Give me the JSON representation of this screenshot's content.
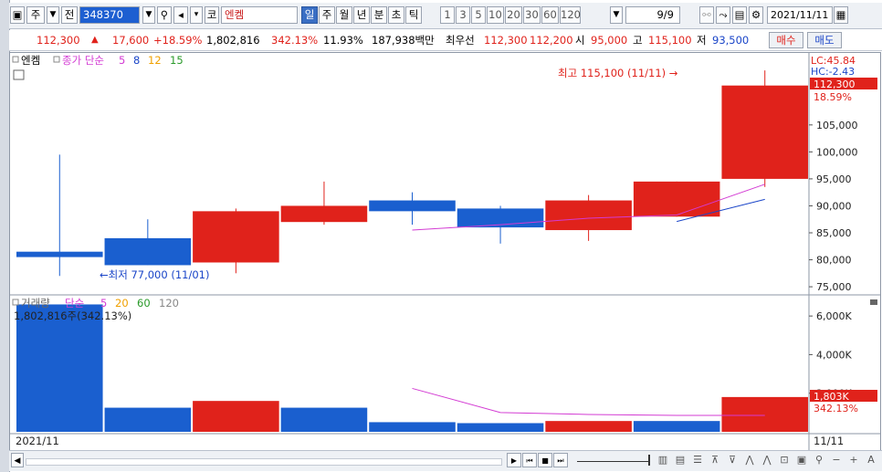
{
  "toolbar": {
    "type_label": "주",
    "jeon_label": "전",
    "code": "348370",
    "market_label": "코",
    "name": "엔켐",
    "periods": [
      "일",
      "주",
      "월",
      "년",
      "분",
      "초",
      "틱"
    ],
    "selected_period": "일",
    "intervals": [
      "1",
      "3",
      "5",
      "10",
      "20",
      "30",
      "60",
      "120"
    ],
    "page_label": "9/9",
    "date": "2021/11/11"
  },
  "quote": {
    "price": "112,300",
    "arrow": "▲",
    "change": "17,600",
    "change_pct": "+18.59%",
    "volume": "1,802,816",
    "volume_ratio": "342.13%",
    "turnover": "11.93%",
    "amount": "187,938백만",
    "best_label": "최우선",
    "ask": "112,300",
    "bid": "112,200",
    "open_label": "시",
    "open": "95,000",
    "high_label": "고",
    "high": "115,100",
    "low_label": "저",
    "low": "93,500",
    "buy_label": "매수",
    "sell_label": "매도"
  },
  "price_panel": {
    "legend_name": "엔켐",
    "legend_ma": "종가 단순",
    "ma_periods": [
      {
        "p": "5",
        "color": "#d33bd3"
      },
      {
        "p": "8",
        "color": "#1a45c8"
      },
      {
        "p": "12",
        "color": "#f0a000"
      },
      {
        "p": "15",
        "color": "#2a9a2a"
      }
    ],
    "lc": "LC:45.84",
    "hc": "HC:-2.43",
    "last_price_tag": "112,300",
    "last_pct_tag": "18.59%",
    "high_note": "최고 115,100 (11/11) →",
    "low_note": "←최저 77,000 (11/01)"
  },
  "volume_panel": {
    "legend_name": "거래량",
    "legend_ma": "단순",
    "ma_periods": [
      {
        "p": "5",
        "color": "#d33bd3"
      },
      {
        "p": "20",
        "color": "#f0a000"
      },
      {
        "p": "60",
        "color": "#2a9a2a"
      },
      {
        "p": "120",
        "color": "#888888"
      }
    ],
    "value_text": "1,802,816주(342.13%)",
    "last_vol_tag": "1,803K",
    "last_pct_tag": "342.13%"
  },
  "x_axis": {
    "left_label": "2021/11",
    "right_label": "11/11"
  },
  "chart_data": [
    {
      "type": "candlestick",
      "title": "엔켐",
      "price_ticks": [
        75000,
        80000,
        85000,
        90000,
        95000,
        100000,
        105000
      ],
      "ylim": [
        74000,
        118000
      ],
      "candles": [
        {
          "open": 80500,
          "close": 81500,
          "high": 99500,
          "low": 77000,
          "dir": "down"
        },
        {
          "open": 84000,
          "close": 79000,
          "high": 87500,
          "low": 79000,
          "dir": "down"
        },
        {
          "open": 79500,
          "close": 89000,
          "high": 89500,
          "low": 77500,
          "dir": "up"
        },
        {
          "open": 87000,
          "close": 90000,
          "high": 94500,
          "low": 86500,
          "dir": "up"
        },
        {
          "open": 91000,
          "close": 89000,
          "high": 92500,
          "low": 86500,
          "dir": "down"
        },
        {
          "open": 89500,
          "close": 86000,
          "high": 90000,
          "low": 83000,
          "dir": "down"
        },
        {
          "open": 85500,
          "close": 91000,
          "high": 92000,
          "low": 83500,
          "dir": "up"
        },
        {
          "open": 88000,
          "close": 94500,
          "high": 94500,
          "low": 88000,
          "dir": "up"
        },
        {
          "open": 95000,
          "close": 112300,
          "high": 115100,
          "low": 93500,
          "dir": "up"
        }
      ],
      "ma5": [
        null,
        null,
        null,
        null,
        85500,
        86500,
        87700,
        88300,
        94000
      ],
      "ma8": [
        null,
        null,
        null,
        null,
        null,
        null,
        null,
        87100,
        91200
      ]
    },
    {
      "type": "bar",
      "title": "거래량",
      "volume_ticks_k": [
        2000,
        4000,
        6000
      ],
      "ylim_k": [
        0,
        7000
      ],
      "values_k": [
        6600,
        1250,
        1600,
        1250,
        500,
        450,
        560,
        560,
        1803
      ],
      "dirs": [
        "down",
        "down",
        "up",
        "down",
        "down",
        "down",
        "up",
        "down",
        "up"
      ],
      "ma5_k": [
        null,
        null,
        null,
        null,
        2250,
        1000,
        900,
        850,
        850
      ]
    }
  ]
}
